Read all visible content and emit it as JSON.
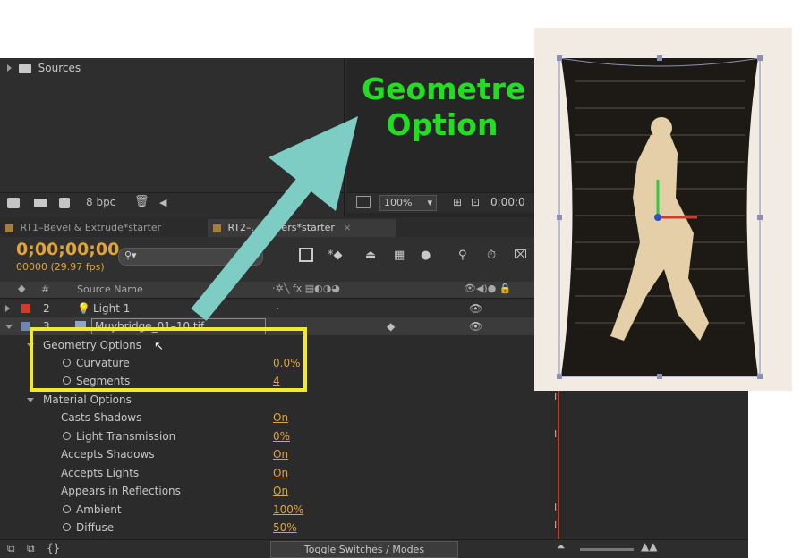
{
  "project": {
    "folder_label": "Sources",
    "bpc_label": "8 bpc"
  },
  "viewer": {
    "zoom": "100%",
    "timecode": "0;00;0"
  },
  "tabs": [
    {
      "label": "RT1–Bevel & Extrude*starter"
    },
    {
      "label": "RT2–… Layers*starter"
    }
  ],
  "comp": {
    "timecode": "0;00;00;00",
    "frame_info": "00000 (29.97 fps)",
    "search_placeholder": ""
  },
  "columns": {
    "hash": "#",
    "source_name": "Source Name"
  },
  "layers": [
    {
      "num": "2",
      "name": "Light 1"
    },
    {
      "num": "3",
      "name": "Muybridge_01–10.tif"
    }
  ],
  "geometry": {
    "title": "Geometry Options",
    "curvature": {
      "label": "Curvature",
      "value": "0.0%"
    },
    "segments": {
      "label": "Segments",
      "value": "4"
    }
  },
  "material": {
    "title": "Material Options",
    "casts_shadows": {
      "label": "Casts Shadows",
      "value": "On"
    },
    "light_transmission": {
      "label": "Light Transmission",
      "value": "0%"
    },
    "accepts_shadows": {
      "label": "Accepts Shadows",
      "value": "On"
    },
    "accepts_lights": {
      "label": "Accepts Lights",
      "value": "On"
    },
    "appears_in_reflections": {
      "label": "Appears in Reflections",
      "value": "On"
    },
    "ambient": {
      "label": "Ambient",
      "value": "100%"
    },
    "diffuse": {
      "label": "Diffuse",
      "value": "50%"
    }
  },
  "footer": {
    "toggle_label": "Toggle Switches / Modes"
  },
  "annotation": {
    "line1": "Geometre",
    "line2": "Option"
  },
  "colors": {
    "accent_orange": "#e1a43a",
    "highlight_yellow": "#f2e830",
    "arrow_teal": "#7ecdc4",
    "annotation_green": "#22dd22",
    "light_red": "#d23a2a"
  }
}
